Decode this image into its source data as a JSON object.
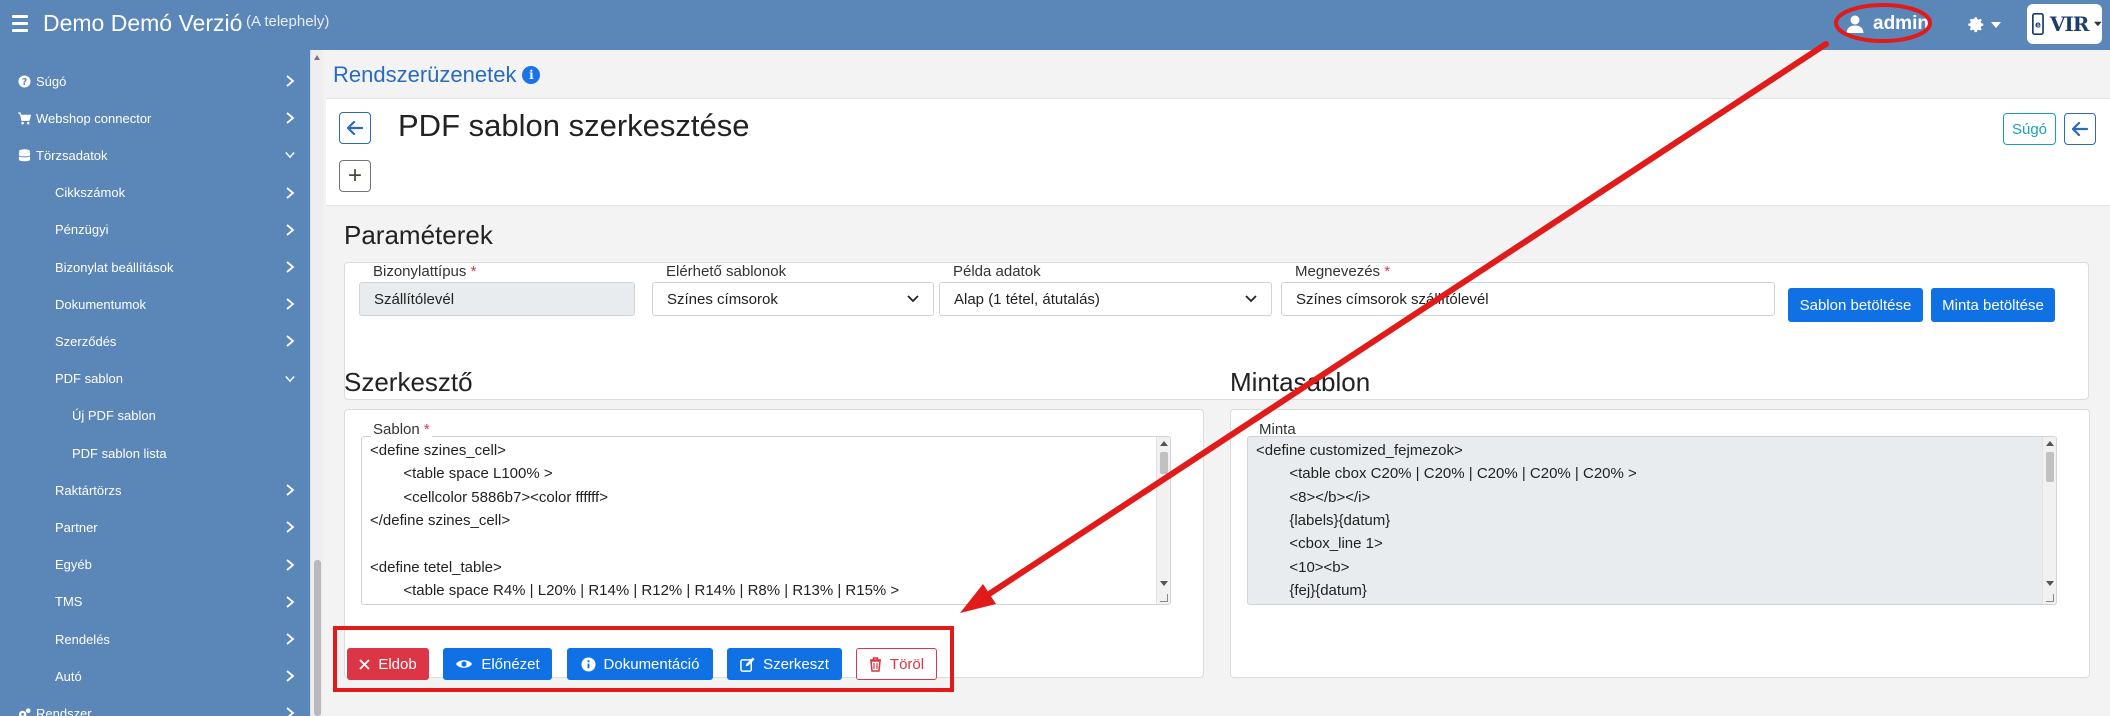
{
  "app": {
    "title": "Demo Demó Verzió",
    "site": "(A telephely)"
  },
  "user": {
    "name": "admin"
  },
  "logo": {
    "text": "VIR"
  },
  "sidebar": {
    "items": [
      {
        "label": "Súgó",
        "icon": "question-circle-icon",
        "level": 0,
        "chevron": "right"
      },
      {
        "label": "Webshop connector",
        "icon": "cart-icon",
        "level": 0,
        "chevron": "right"
      },
      {
        "label": "Törzsadatok",
        "icon": "database-icon",
        "level": 0,
        "chevron": "down"
      },
      {
        "label": "Cikkszámok",
        "level": 1,
        "chevron": "right"
      },
      {
        "label": "Pénzügyi",
        "level": 1,
        "chevron": "right"
      },
      {
        "label": "Bizonylat beállítások",
        "level": 1,
        "chevron": "right"
      },
      {
        "label": "Dokumentumok",
        "level": 1,
        "chevron": "right"
      },
      {
        "label": "Szerződés",
        "level": 1,
        "chevron": "right"
      },
      {
        "label": "PDF sablon",
        "level": 1,
        "chevron": "down"
      },
      {
        "label": "Új PDF sablon",
        "level": 2,
        "chevron": ""
      },
      {
        "label": "PDF sablon lista",
        "level": 2,
        "chevron": ""
      },
      {
        "label": "Raktártörzs",
        "level": 1,
        "chevron": "right"
      },
      {
        "label": "Partner",
        "level": 1,
        "chevron": "right"
      },
      {
        "label": "Egyéb",
        "level": 1,
        "chevron": "right"
      },
      {
        "label": "TMS",
        "level": 1,
        "chevron": "right"
      },
      {
        "label": "Rendelés",
        "level": 1,
        "chevron": "right"
      },
      {
        "label": "Autó",
        "level": 1,
        "chevron": "right"
      },
      {
        "label": "Rendszer",
        "icon": "cogs-icon",
        "level": 0,
        "chevron": "right"
      }
    ]
  },
  "breadcrumb": "Rendszerüzenetek",
  "page": {
    "title": "PDF sablon szerkesztése",
    "help_label": "Súgó"
  },
  "params": {
    "title": "Paraméterek",
    "doc_type_label": "Bizonylattípus",
    "doc_type_value": "Szállítólevél",
    "templates_label": "Elérhető sablonok",
    "templates_value": "Színes címsorok",
    "sample_label": "Példa adatok",
    "sample_value": "Alap (1 tétel, átutalás)",
    "name_label": "Megnevezés",
    "name_value": "Színes címsorok szállítólevél",
    "load_template_label": "Sablon betöltése",
    "load_sample_label": "Minta betöltése"
  },
  "editor": {
    "title": "Szerkesztő",
    "field_label": "Sablon",
    "lines": [
      "<define szines_cell>",
      "        <table space L100% >",
      "        <cellcolor 5886b7><color ffffff>",
      "</define szines_cell>",
      "",
      "<define tetel_table>",
      "        <table space R4% | L20% | R14% | R12% | R14% | R8% | R13% | R15% >"
    ]
  },
  "sample": {
    "title": "Mintasablon",
    "field_label": "Minta",
    "lines": [
      "<define customized_fejmezok>",
      "        <table cbox C20% | C20% | C20% | C20% | C20% >",
      "        <8></b></i>",
      "        {labels}{datum}",
      "        <cbox_line 1>",
      "        <10><b>",
      "        {fej}{datum}"
    ]
  },
  "actions": {
    "discard": "Eldob",
    "preview": "Előnézet",
    "docs": "Dokumentáció",
    "edit": "Szerkeszt",
    "delete": "Töröl"
  },
  "colors": {
    "topbar": "#5b86b8",
    "primary": "#1071e5",
    "danger": "#dc3545",
    "info": "#17a2b8",
    "annotation": "#e11a1a"
  }
}
